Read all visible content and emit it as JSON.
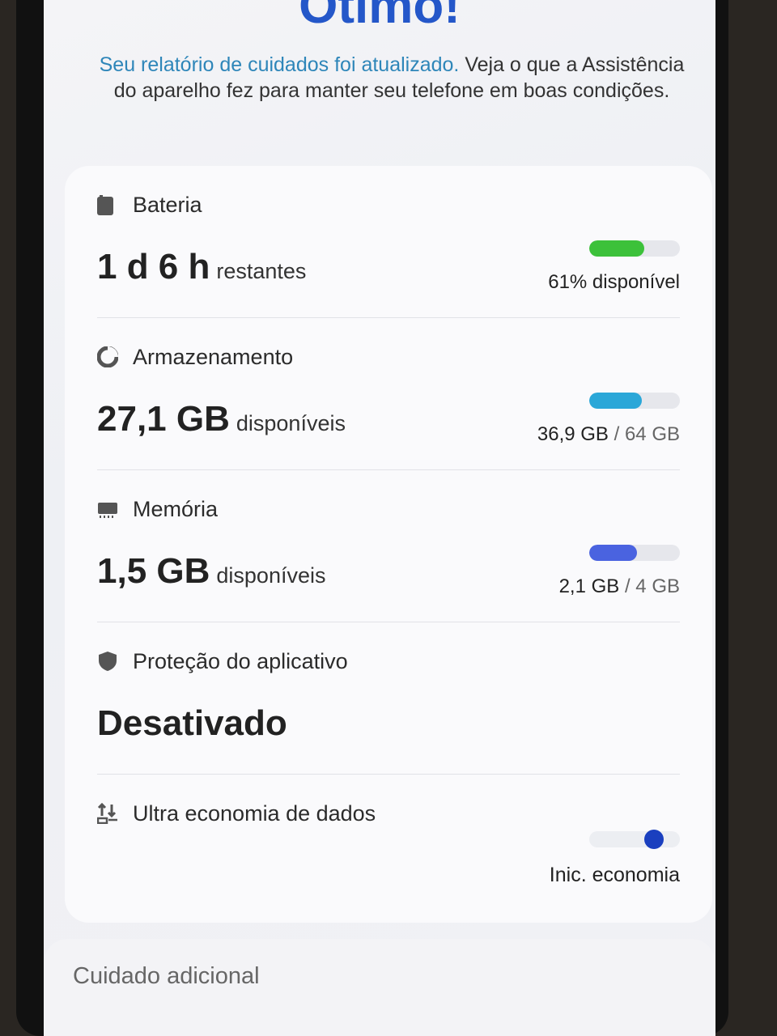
{
  "header": {
    "title": "Ótimo!",
    "subtitle_link": "Seu relatório de cuidados foi atualizado.",
    "subtitle_rest": "Veja o que a Assistência do aparelho fez para manter seu telefone em boas condições."
  },
  "battery": {
    "title": "Bateria",
    "icon": "battery-icon",
    "value": "1 d 6 h",
    "unit": "restantes",
    "label": "61% disponível",
    "level": 0.61,
    "color": "#3cc13a"
  },
  "storage": {
    "title": "Armazenamento",
    "icon": "storage-pie-icon",
    "value": "27,1 GB",
    "unit": "disponíveis",
    "used": "36,9 GB",
    "separator": "/",
    "total": "64 GB",
    "level": 0.58,
    "color": "#2aa7d8"
  },
  "memory": {
    "title": "Memória",
    "icon": "memory-chip-icon",
    "value": "1,5 GB",
    "unit": "disponíveis",
    "used": "2,1 GB",
    "separator": "/",
    "total": "4 GB",
    "level": 0.53,
    "color": "#4a63e0"
  },
  "app_protection": {
    "title": "Proteção do aplicativo",
    "icon": "shield-icon",
    "value": "Desativado"
  },
  "data_saver": {
    "title": "Ultra economia de dados",
    "icon": "data-saver-icon",
    "action": "Inic. economia",
    "dot_color": "#1a3fbf"
  },
  "extra_care": {
    "title": "Cuidado adicional"
  }
}
